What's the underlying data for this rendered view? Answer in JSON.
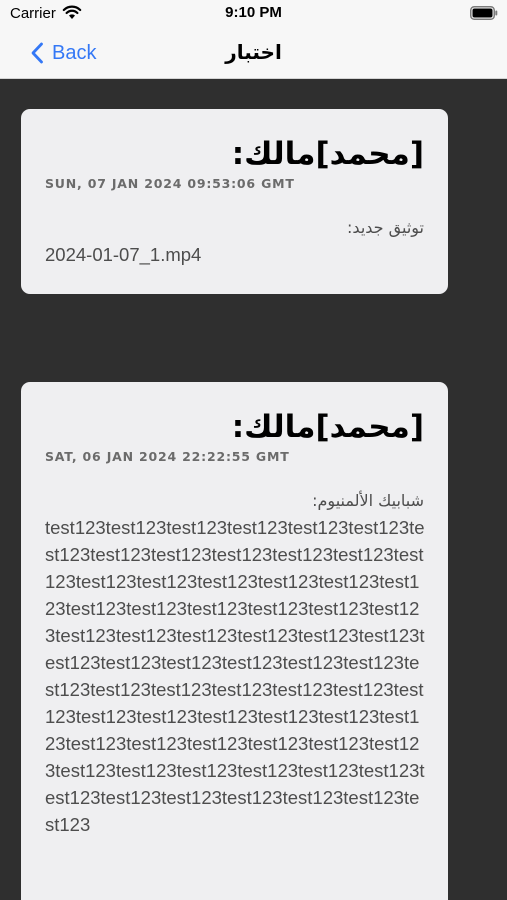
{
  "status_bar": {
    "carrier": "Carrier",
    "time": "9:10 PM"
  },
  "nav": {
    "back_label": "Back",
    "title": "اختبار"
  },
  "messages": [
    {
      "sender": "[محمد]مالك:",
      "timestamp": "SUN, 07 JAN 2024 09:53:06 GMT",
      "label": "توثيق جديد:",
      "text": "2024-01-07_1.mp4"
    },
    {
      "sender": "[محمد]مالك:",
      "timestamp": "SAT, 06 JAN 2024 22:22:55 GMT",
      "label": "شبابيك الألمنيوم:",
      "text": "test123test123test123test123test123test123test123test123test123test123test123test123test123test123test123test123test123test123test123test123test123test123test123test123test123test123test123test123test123test123test123test123test123test123test123test123test123test123test123test123test123test123test123test123test123test123test123test123test123test123test123test123test123test123test123test123test123test123test123test123test123test123test123test123test123test123test123test123test123"
    }
  ],
  "colors": {
    "background": "#2f2f2f",
    "card": "#efeff1",
    "accent": "#3478f6"
  },
  "icons": {
    "wifi": "wifi-icon",
    "battery": "battery-icon",
    "back": "chevron-left-icon"
  }
}
